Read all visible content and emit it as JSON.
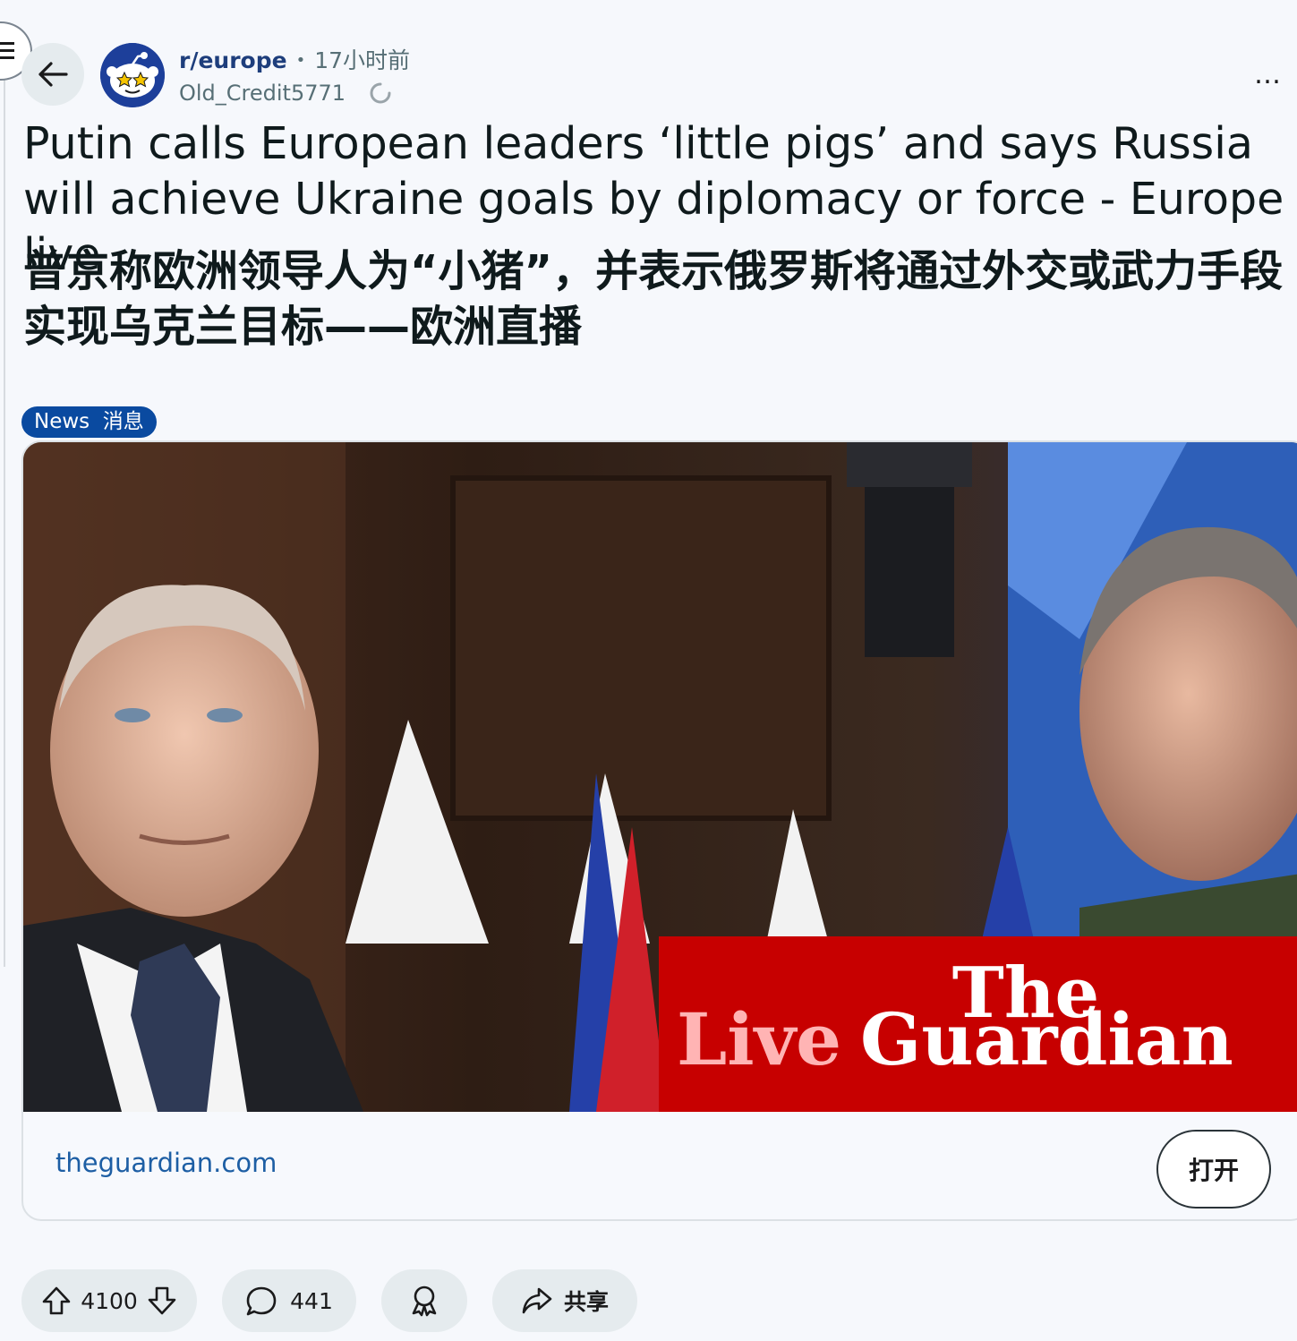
{
  "header": {
    "subreddit": "r/europe",
    "separator": "•",
    "time_ago": "17小时前",
    "username": "Old_Credit5771",
    "more_label": "…"
  },
  "post": {
    "title_en": "Putin calls European leaders ‘little pigs’ and says Russia will achieve Ukraine goals by diplomacy or force - Europe live",
    "title_zh": "普京称欧洲领导人为“小猪”，并表示俄罗斯将通过外交或武力手段实现乌克兰目标——欧洲直播",
    "flair": "News  消息"
  },
  "link_card": {
    "thumbnail_overlay_live": "Live",
    "thumbnail_overlay_the": "The",
    "thumbnail_overlay_guardian": "Guardian",
    "domain": "theguardian.com",
    "open_label": "打开"
  },
  "actions": {
    "score": "4100",
    "comments": "441",
    "share_label": "共享"
  },
  "colors": {
    "flair_bg": "#0a4aa0",
    "domain_link": "#1d5ea4",
    "guardian_red": "#c70000",
    "avatar_bg": "#1d3f9a"
  },
  "icons": [
    "menu-icon",
    "back-arrow-icon",
    "subreddit-avatar-icon",
    "loading-spinner-icon",
    "more-icon",
    "upvote-icon",
    "downvote-icon",
    "comment-icon",
    "award-icon",
    "share-icon"
  ]
}
